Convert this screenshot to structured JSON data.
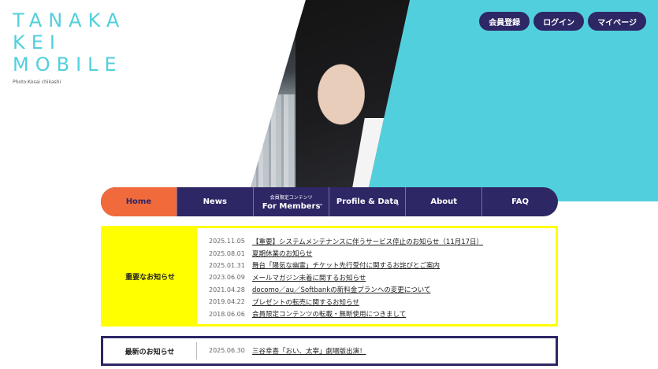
{
  "logo": {
    "lines": [
      "TANAKA",
      "KEI",
      "MOBILE"
    ],
    "credit": "Photo:Kosai chikashi"
  },
  "header_buttons": [
    "会員登録",
    "ログイン",
    "マイページ"
  ],
  "nav": [
    {
      "label": "Home",
      "sub": "",
      "dropdown": false
    },
    {
      "label": "News",
      "sub": "",
      "dropdown": false
    },
    {
      "label": "For Members",
      "sub": "会員限定コンテンツ",
      "dropdown": true
    },
    {
      "label": "Profile & Data",
      "sub": "",
      "dropdown": true
    },
    {
      "label": "About",
      "sub": "",
      "dropdown": false
    },
    {
      "label": "FAQ",
      "sub": "",
      "dropdown": false
    }
  ],
  "important": {
    "label": "重要なお知らせ",
    "items": [
      {
        "date": "2025.11.05",
        "title": "【重要】システムメンテナンスに伴うサービス停止のお知らせ（11月17日）"
      },
      {
        "date": "2025.08.01",
        "title": "夏期休業のお知らせ"
      },
      {
        "date": "2025.01.31",
        "title": "舞台「陽気な幽霊」チケット先行受付に関するお詫びとご案内"
      },
      {
        "date": "2023.06.09",
        "title": "メールマガジン未着に関するお知らせ"
      },
      {
        "date": "2021.04.28",
        "title": "docomo／au／Softbankの新料金プランへの変更について"
      },
      {
        "date": "2019.04.22",
        "title": "プレゼントの転売に関するお知らせ"
      },
      {
        "date": "2018.06.06",
        "title": "会員限定コンテンツの転載・無断使用につきまして"
      }
    ]
  },
  "latest": {
    "label": "最新のお知らせ",
    "items": [
      {
        "date": "2025.06.30",
        "title": "三谷幸喜「おい、太宰」劇場版出演！"
      }
    ]
  },
  "colors": {
    "accent": "#52cfdc",
    "navy": "#2d2766",
    "orange": "#f16a3c",
    "yellow": "#ffff00"
  }
}
